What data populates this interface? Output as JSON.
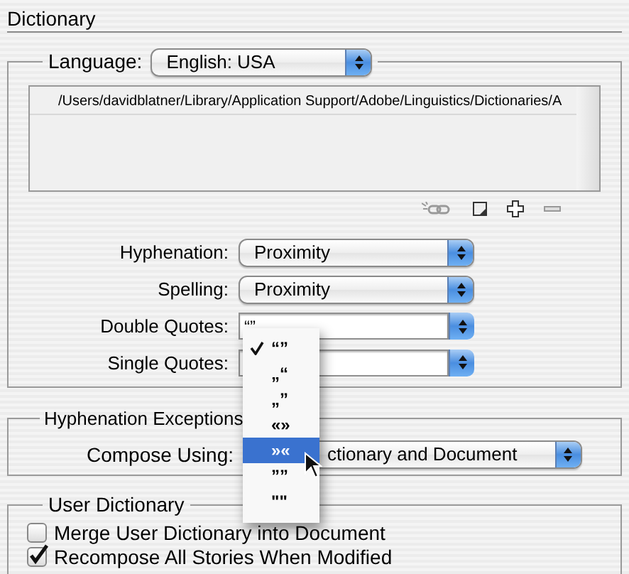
{
  "section_title": "Dictionary",
  "language": {
    "label": "Language:",
    "value": "English: USA"
  },
  "dictionary_list": {
    "rows": [
      "/Users/davidblatner/Library/Application Support/Adobe/Linguistics/Dictionaries/A"
    ]
  },
  "settings": [
    {
      "label": "Hyphenation:",
      "kind": "select",
      "value": "Proximity"
    },
    {
      "label": "Spelling:",
      "kind": "select",
      "value": "Proximity"
    },
    {
      "label": "Double Quotes:",
      "kind": "combo",
      "value": "“”"
    },
    {
      "label": "Single Quotes:",
      "kind": "combo"
    }
  ],
  "quotes_menu": {
    "items": [
      {
        "label": "“”",
        "checked": true,
        "selected": false
      },
      {
        "label": "„“",
        "checked": false,
        "selected": false
      },
      {
        "label": "„”",
        "checked": false,
        "selected": false
      },
      {
        "label": "«»",
        "checked": false,
        "selected": false
      },
      {
        "label": "»«",
        "checked": false,
        "selected": true
      },
      {
        "label": "””",
        "checked": false,
        "selected": false
      },
      {
        "label": "\"\"",
        "checked": false,
        "selected": false
      }
    ]
  },
  "hyphenation_exceptions": {
    "title": "Hyphenation Exceptions",
    "label": "Compose Using:",
    "value": "ctionary and Document"
  },
  "user_dictionary": {
    "title": "User Dictionary",
    "options": [
      {
        "label": "Merge User Dictionary into Document",
        "checked": false
      },
      {
        "label": "Recompose All Stories When Modified",
        "checked": true
      }
    ]
  }
}
